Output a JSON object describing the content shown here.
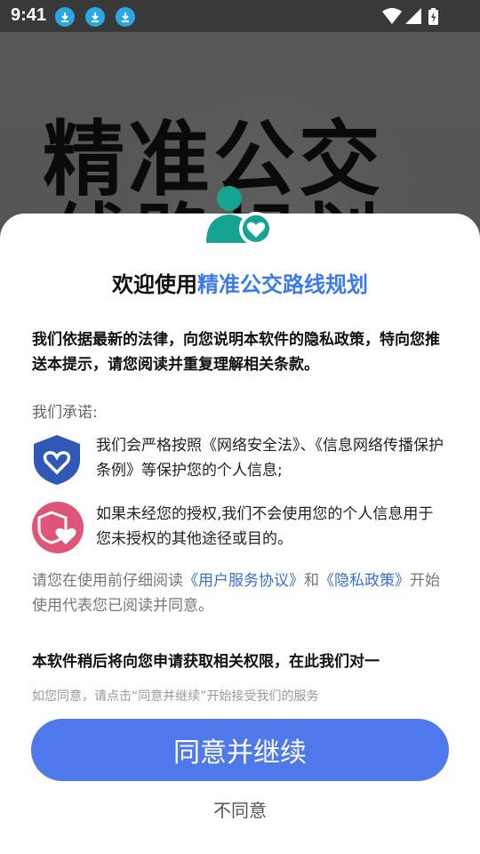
{
  "status_bar": {
    "time": "9:41",
    "notification_icons": [
      "download-icon",
      "download-icon",
      "download-icon"
    ],
    "system_icons": [
      "wifi-icon",
      "signal-icon",
      "battery-charging-icon"
    ]
  },
  "background": {
    "title_line1": "精准公交",
    "title_line2": "线路规划"
  },
  "dialog": {
    "title_prefix": "欢迎使用",
    "title_app_name": "精准公交路线规划",
    "intro": "我们依据最新的法律，向您说明本软件的隐私政策，特向您推送本提示，请您阅读并重复理解相关条款。",
    "promise_label": "我们承诺:",
    "promises": [
      {
        "icon": "shield-heart-icon",
        "text": "我们会严格按照《网络安全法》、《信息网络传播保护条例》等保护您的个人信息;"
      },
      {
        "icon": "heart-shield-icon",
        "text": "如果未经您的授权,我们不会使用您的个人信息用于您未授权的其他途径或目的。"
      }
    ],
    "read_prefix": "请您在使用前仔细阅读",
    "user_agreement_link": "《用户服务协议》",
    "and_text": "和",
    "privacy_policy_link": "《隐私政策》",
    "read_suffix": "开始使用代表您已阅读并同意。",
    "permission_notice": "本软件稍后将向您申请获取相关权限，在此我们对一",
    "hint": "如您同意，请点击“同意并继续”开始接受我们的服务",
    "agree_button": "同意并继续",
    "disagree_button": "不同意"
  },
  "colors": {
    "accent": "#3b7bf0",
    "button": "#4f79ea",
    "avatar_teal": "#17a392",
    "shield_blue": "#3058b8",
    "heart_pink": "#e05478"
  }
}
